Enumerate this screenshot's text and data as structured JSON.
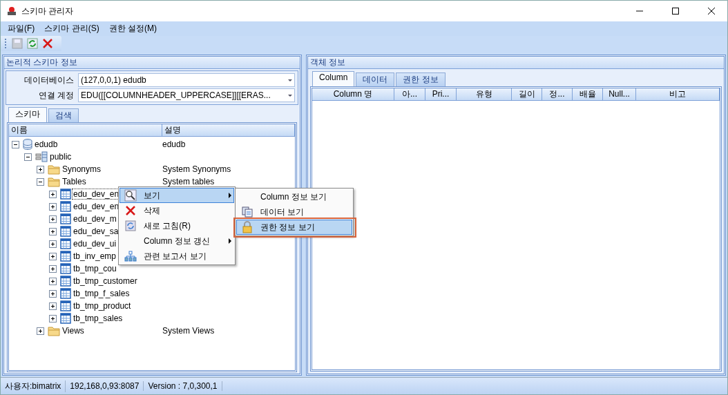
{
  "window": {
    "title": "스키마 관리자"
  },
  "menu_bar": [
    "파일(F)",
    "스키마 관리(S)",
    "권한 설정(M)"
  ],
  "toolbar": [
    {
      "kind": "save",
      "disabled": true
    },
    {
      "kind": "refresh",
      "disabled": false
    },
    {
      "kind": "delete",
      "disabled": false
    }
  ],
  "left_panel": {
    "title": "논리적 스키마 정보",
    "fields": [
      {
        "label": "데이터베이스",
        "value": "(127,0,0,1) edudb"
      },
      {
        "label": "연결 계정",
        "value": "EDU([[COLUMNHEADER_UPPERCASE]][[ERAS..."
      }
    ],
    "tabs": [
      {
        "label": "스키마",
        "selected": true
      },
      {
        "label": "검색",
        "selected": false
      }
    ],
    "tree": {
      "columns": [
        "이름",
        "설명"
      ],
      "items": [
        {
          "kind": "database",
          "name": "edudb",
          "description": "edudb",
          "expanded": true,
          "children": [
            {
              "kind": "schema",
              "name": "public",
              "expanded": true,
              "children": [
                {
                  "kind": "folder",
                  "name": "Synonyms",
                  "description": "System Synonyms",
                  "expanded": false
                },
                {
                  "kind": "folder",
                  "name": "Tables",
                  "description": "System tables",
                  "expanded": true,
                  "children": [
                    {
                      "kind": "table",
                      "name": "edu_dev_en",
                      "expanded": false,
                      "selected": true
                    },
                    {
                      "kind": "table",
                      "name": "edu_dev_en",
                      "expanded": false,
                      "selected": false
                    },
                    {
                      "kind": "table",
                      "name": "edu_dev_m",
                      "expanded": false,
                      "selected": false
                    },
                    {
                      "kind": "table",
                      "name": "edu_dev_sa",
                      "expanded": false,
                      "selected": false
                    },
                    {
                      "kind": "table",
                      "name": "edu_dev_ui",
                      "expanded": false,
                      "selected": false
                    },
                    {
                      "kind": "table",
                      "name": "tb_inv_emp",
                      "expanded": false,
                      "selected": false
                    },
                    {
                      "kind": "table",
                      "name": "tb_tmp_cou",
                      "expanded": false,
                      "selected": false
                    },
                    {
                      "kind": "table",
                      "name": "tb_tmp_customer",
                      "expanded": false,
                      "selected": false
                    },
                    {
                      "kind": "table",
                      "name": "tb_tmp_f_sales",
                      "expanded": false,
                      "selected": false
                    },
                    {
                      "kind": "table",
                      "name": "tb_tmp_product",
                      "expanded": false,
                      "selected": false
                    },
                    {
                      "kind": "table",
                      "name": "tb_tmp_sales",
                      "expanded": false,
                      "selected": false
                    }
                  ]
                },
                {
                  "kind": "folder",
                  "name": "Views",
                  "description": "System Views",
                  "expanded": false
                }
              ]
            }
          ]
        }
      ]
    }
  },
  "context_menu": {
    "items": [
      {
        "kind": "view",
        "label": "보기",
        "submenu": true,
        "selected": true
      },
      {
        "kind": "delete",
        "label": "삭제",
        "submenu": false,
        "selected": false
      },
      {
        "kind": "refresh",
        "label": "새로 고침(R)",
        "submenu": false,
        "selected": false
      },
      {
        "kind": "plain",
        "label": "Column 정보 갱신",
        "submenu": true,
        "selected": false
      },
      {
        "kind": "report",
        "label": "관련 보고서 보기",
        "submenu": false,
        "selected": false
      }
    ],
    "submenu": [
      {
        "kind": "plain",
        "label": "Column 정보 보기",
        "selected": false
      },
      {
        "kind": "data",
        "label": "데이터 보기",
        "selected": false
      },
      {
        "kind": "lock",
        "label": "권한 정보 보기",
        "selected": true
      }
    ]
  },
  "right_panel": {
    "title": "객체 정보",
    "tabs": [
      {
        "label": "Column",
        "selected": true
      },
      {
        "label": "데이터",
        "selected": false
      },
      {
        "label": "권한 정보",
        "selected": false
      }
    ],
    "columns": [
      "Column 명",
      "아...",
      "Pri...",
      "유형",
      "길이",
      "정...",
      "배율",
      "Null...",
      "비고"
    ]
  },
  "status_bar": [
    "사용자:bimatrix",
    "192,168,0,93:8087",
    "Version : 7,0,300,1"
  ]
}
